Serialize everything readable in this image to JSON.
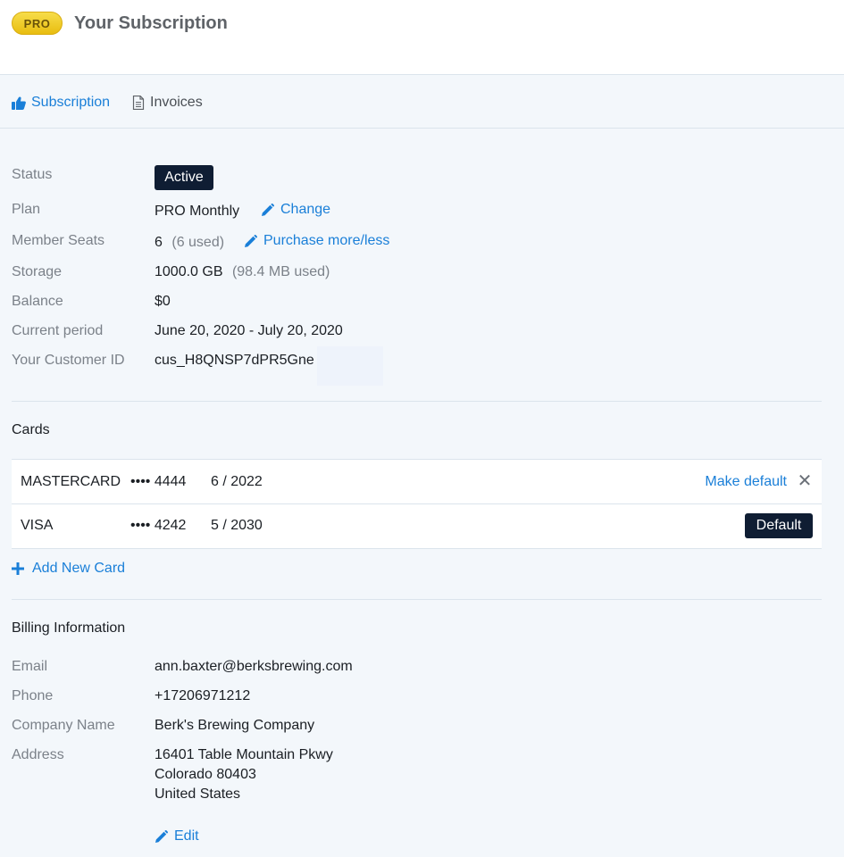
{
  "header": {
    "badge": "PRO",
    "title": "Your Subscription"
  },
  "tabs": [
    {
      "label": "Subscription",
      "icon": "thumbs-up-icon",
      "active": true
    },
    {
      "label": "Invoices",
      "icon": "document-icon",
      "active": false
    }
  ],
  "subscription": {
    "status_label": "Status",
    "status_value": "Active",
    "plan_label": "Plan",
    "plan_value": "PRO Monthly",
    "plan_change": "Change",
    "seats_label": "Member Seats",
    "seats_value": "6",
    "seats_used": "(6 used)",
    "seats_purchase": "Purchase more/less",
    "storage_label": "Storage",
    "storage_value": "1000.0 GB",
    "storage_used": "(98.4 MB used)",
    "balance_label": "Balance",
    "balance_value": "$0",
    "period_label": "Current period",
    "period_value": "June 20, 2020 - July 20, 2020",
    "customer_label": "Your Customer ID",
    "customer_value": "cus_H8QNSP7dPR5Gne"
  },
  "cards": {
    "title": "Cards",
    "items": [
      {
        "brand": "MASTERCARD",
        "last4": "•••• 4444",
        "expiry": "6 / 2022",
        "action": "Make default",
        "remove": "✕"
      },
      {
        "brand": "VISA",
        "last4": "•••• 4242",
        "expiry": "5 / 2030",
        "badge": "Default"
      }
    ],
    "add_label": "Add New Card"
  },
  "billing": {
    "title": "Billing Information",
    "email_label": "Email",
    "email_value": "ann.baxter@berksbrewing.com",
    "phone_label": "Phone",
    "phone_value": "+17206971212",
    "company_label": "Company Name",
    "company_value": "Berk's Brewing Company",
    "address_label": "Address",
    "address_line1": "16401 Table Mountain Pkwy",
    "address_line2": "Colorado 80403",
    "address_line3": "United States",
    "edit_label": "Edit"
  },
  "colors": {
    "accent": "#1a7fd8",
    "dark_badge": "#0f1d33",
    "background": "#f3f7fb",
    "pro_gold": "#f0cc2a"
  }
}
